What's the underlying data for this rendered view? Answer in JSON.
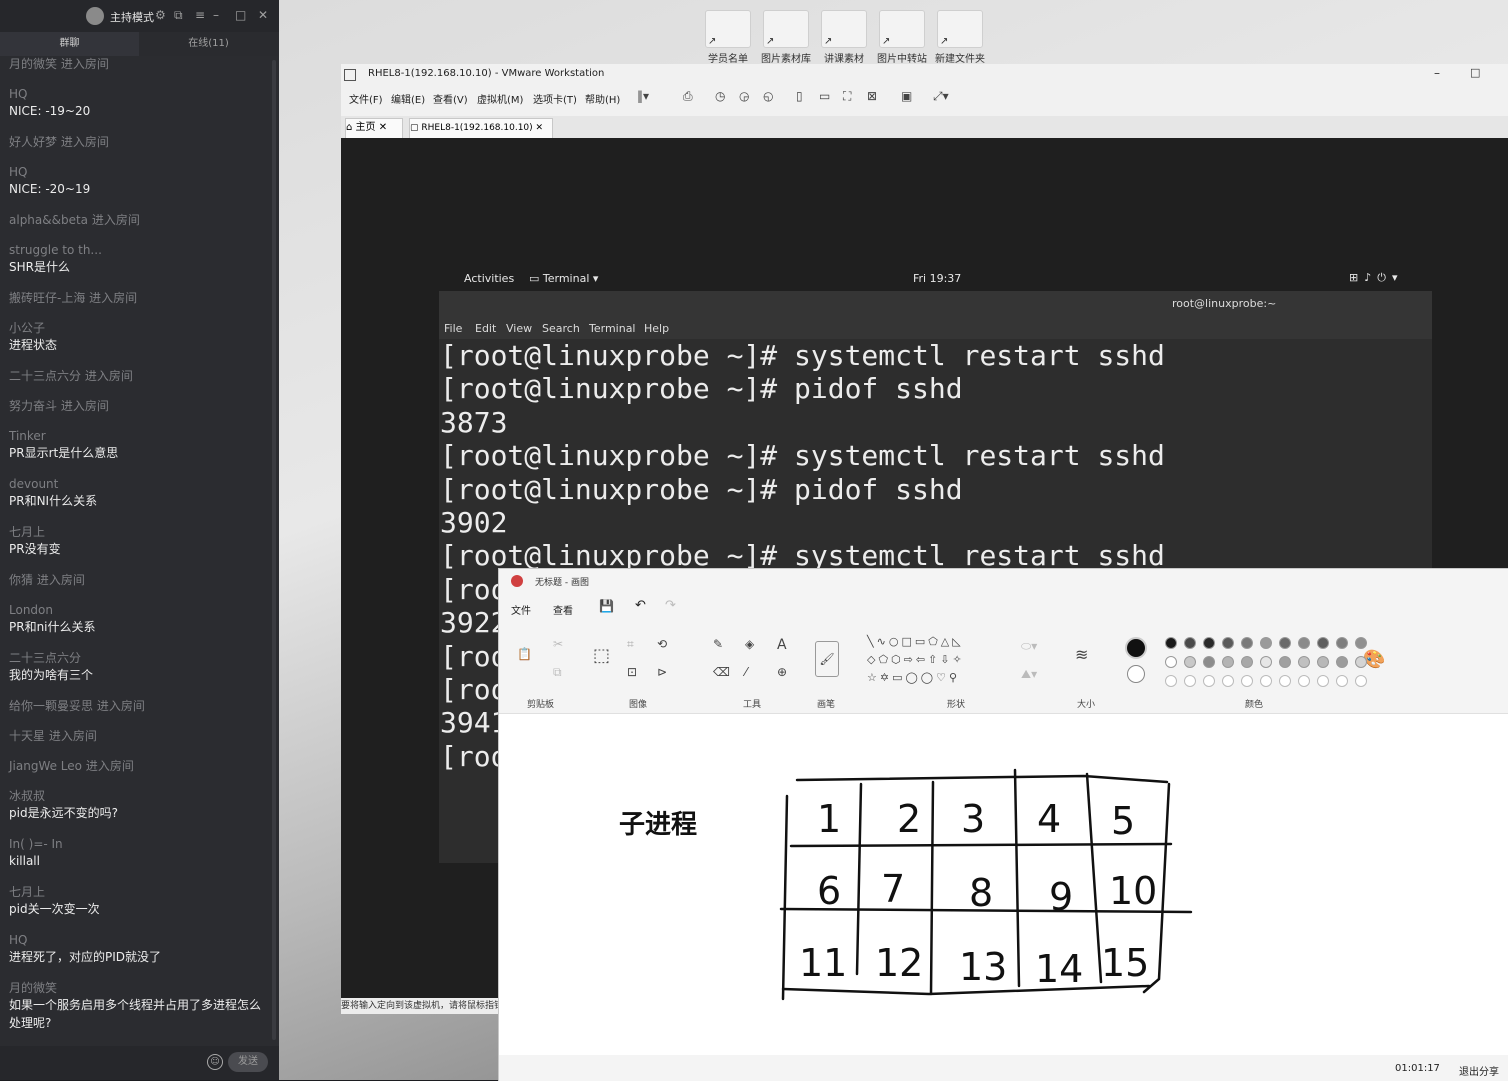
{
  "chat": {
    "mode": "主持模式",
    "tabs": [
      "群聊",
      "在线(11)"
    ],
    "messages": [
      {
        "user": "月的微笑",
        "text": "进入房间",
        "enter": true
      },
      {
        "user": "HQ",
        "text": "NICE: -19~20"
      },
      {
        "user": "好人好梦",
        "text": "进入房间",
        "enter": true
      },
      {
        "user": "HQ",
        "text": "NICE: -20~19"
      },
      {
        "user": "alpha&&beta",
        "text": "进入房间",
        "enter": true
      },
      {
        "user": "struggle to th...",
        "text": "SHR是什么"
      },
      {
        "user": "搬砖旺仔-上海",
        "text": "进入房间",
        "enter": true
      },
      {
        "user": "小公子",
        "text": "进程状态"
      },
      {
        "user": "二十三点六分",
        "text": "进入房间",
        "enter": true
      },
      {
        "user": "努力奋斗",
        "text": "进入房间",
        "enter": true
      },
      {
        "user": "Tinker",
        "text": "PR显示rt是什么意思"
      },
      {
        "user": "devount",
        "text": "PR和NI什么关系"
      },
      {
        "user": "七月上",
        "text": "PR没有变"
      },
      {
        "user": "你猜",
        "text": "进入房间",
        "enter": true
      },
      {
        "user": "London",
        "text": "PR和ni什么关系"
      },
      {
        "user": "二十三点六分",
        "text": "我的为啥有三个"
      },
      {
        "user": "给你一颗曼妥思",
        "text": "进入房间",
        "enter": true
      },
      {
        "user": "十天星",
        "text": "进入房间",
        "enter": true
      },
      {
        "user": "JiangWe Leo",
        "text": "进入房间",
        "enter": true
      },
      {
        "user": "冰叔叔",
        "text": "pid是永远不变的吗?"
      },
      {
        "user": "In(   )=-     In",
        "text": "killall"
      },
      {
        "user": "七月上",
        "text": "pid关一次变一次"
      },
      {
        "user": "HQ",
        "text": "进程死了，对应的PID就没了"
      },
      {
        "user": "月的微笑",
        "text": "如果一个服务启用多个线程并占用了多进程怎么处理呢?"
      }
    ],
    "send_label": "发送"
  },
  "desktop_icons": [
    "学员名单",
    "图片素材库",
    "讲课素材",
    "图片中转站",
    "新建文件夹"
  ],
  "vmware": {
    "title": "RHEL8-1(192.168.10.10) - VMware Workstation",
    "menu": [
      "文件(F)",
      "编辑(E)",
      "查看(V)",
      "虚拟机(M)",
      "选项卡(T)",
      "帮助(H)"
    ],
    "tab_home": "主页",
    "tab_vm": "RHEL8-1(192.168.10.10)",
    "status": "要将输入定向到该虚拟机，请将鼠标指针移入其中或按 Ctrl+G。"
  },
  "gnome": {
    "activities": "Activities",
    "app": "Terminal ▾",
    "clock": "Fri 19:37"
  },
  "terminal": {
    "title": "root@linuxprobe:~",
    "menu": [
      "File",
      "Edit",
      "View",
      "Search",
      "Terminal",
      "Help"
    ],
    "lines": [
      "[root@linuxprobe ~]# systemctl restart sshd",
      "[root@linuxprobe ~]# pidof sshd",
      "3873",
      "[root@linuxprobe ~]# systemctl restart sshd",
      "[root@linuxprobe ~]# pidof sshd",
      "3902",
      "[root@linuxprobe ~]# systemctl restart sshd",
      "[roo",
      "3922",
      "[roo",
      "[roo",
      "3941",
      "[roo"
    ]
  },
  "paint": {
    "title": "无标题 - 画图",
    "menu": [
      "文件",
      "查看"
    ],
    "groups": [
      "剪贴板",
      "图像",
      "工具",
      "画笔",
      "形状",
      "大小",
      "颜色"
    ],
    "canvas_text": "子进程",
    "grid_numbers": [
      "1",
      "2",
      "3",
      "4",
      "5",
      "6",
      "7",
      "8",
      "9",
      "10",
      "11",
      "12",
      "13",
      "14",
      "15"
    ],
    "status_time": "01:01:17",
    "status_exit": "退出分享"
  }
}
